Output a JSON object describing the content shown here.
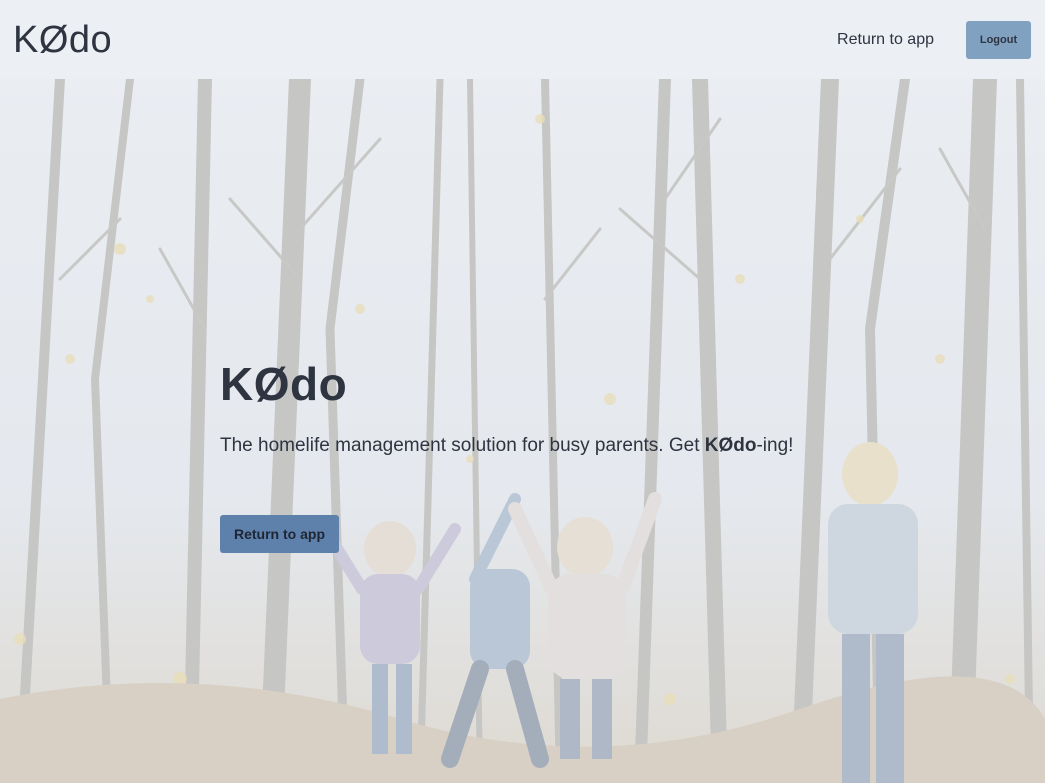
{
  "navbar": {
    "brand": "KØdo",
    "return_link": "Return to app",
    "logout_label": "Logout"
  },
  "hero": {
    "title": "KØdo",
    "tagline_prefix": "The homelife management solution for busy parents. Get ",
    "tagline_brand": "KØdo",
    "tagline_suffix": "-ing!",
    "button_label": "Return to app",
    "background_description_icon": "family-forest-photo"
  },
  "colors": {
    "background": "#eceff4",
    "text": "#2e3440",
    "logout_button": "#81a1c1",
    "primary_button": "#5e81ac"
  }
}
